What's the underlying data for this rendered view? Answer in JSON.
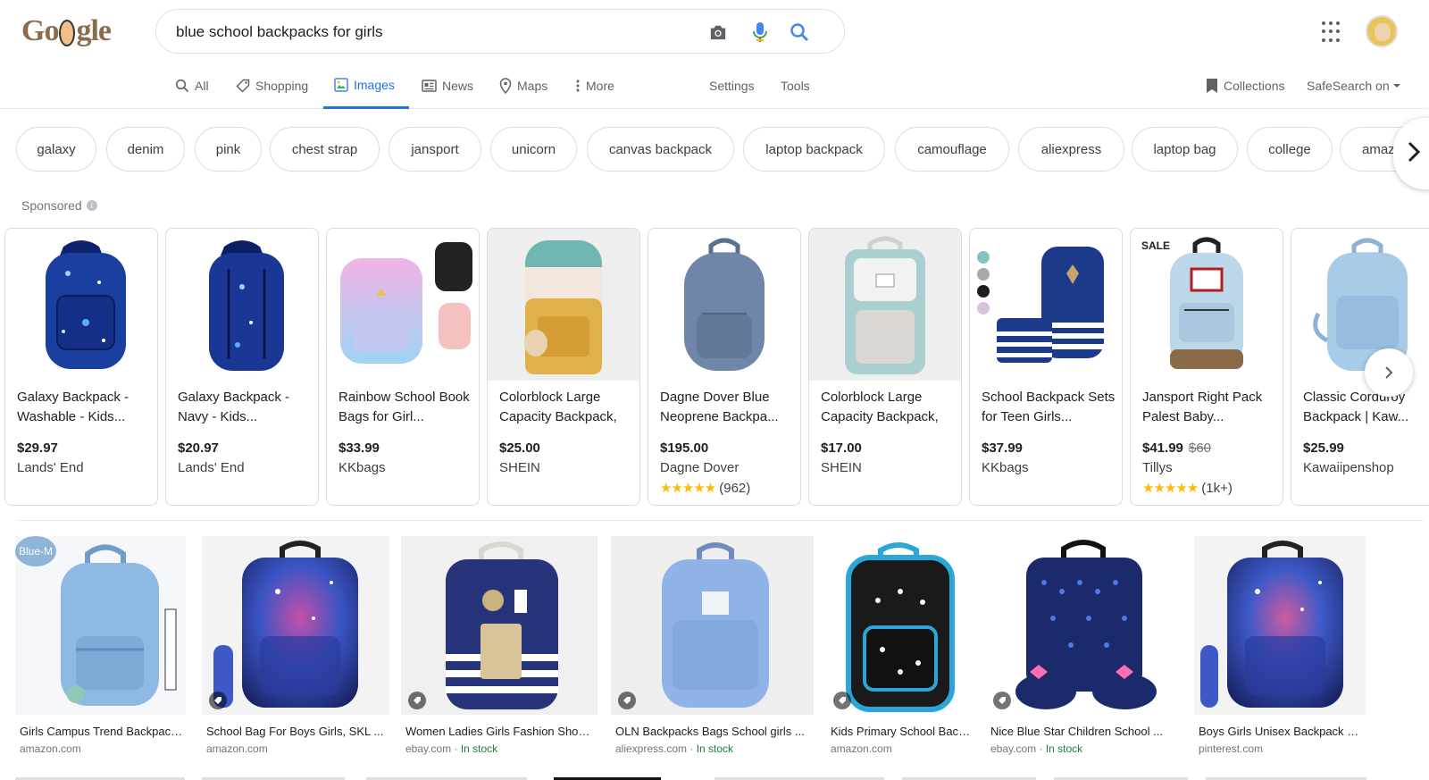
{
  "search": {
    "query": "blue school backpacks for girls"
  },
  "logo": {
    "text_g1": "Go",
    "text_g2": "gle"
  },
  "nav": {
    "all": "All",
    "shopping": "Shopping",
    "images": "Images",
    "news": "News",
    "maps": "Maps",
    "more": "More",
    "settings": "Settings",
    "tools": "Tools",
    "collections": "Collections",
    "safesearch": "SafeSearch on"
  },
  "chips": [
    "galaxy",
    "denim",
    "pink",
    "chest strap",
    "jansport",
    "unicorn",
    "canvas backpack",
    "laptop backpack",
    "camouflage",
    "aliexpress",
    "laptop bag",
    "college",
    "amazon"
  ],
  "sponsored_label": "Sponsored",
  "products": [
    {
      "title": "Galaxy Backpack - Washable - Kids...",
      "price": "$29.97",
      "store": "Lands' End",
      "color": "#1b3fa0"
    },
    {
      "title": "Galaxy Backpack - Navy - Kids...",
      "price": "$20.97",
      "store": "Lands' End",
      "color": "#1a3796"
    },
    {
      "title": "Rainbow School Book Bags for Girl...",
      "price": "$33.99",
      "store": "KKbags",
      "color": "#d9a6e8"
    },
    {
      "title": "Colorblock Large Capacity Backpack,",
      "price": "$25.00",
      "store": "SHEIN",
      "color": "#e0b04a"
    },
    {
      "title": "Dagne Dover Blue Neoprene Backpa...",
      "price": "$195.00",
      "store": "Dagne Dover",
      "rating_stars": "★★★★★",
      "rating_count": "(962)",
      "color": "#6f86a8"
    },
    {
      "title": "Colorblock Large Capacity Backpack,",
      "price": "$17.00",
      "store": "SHEIN",
      "color": "#a9cfcf"
    },
    {
      "title": "School Backpack Sets for Teen Girls...",
      "price": "$37.99",
      "store": "KKbags",
      "color": "#1d3a8a"
    },
    {
      "title": "Jansport Right Pack Palest Baby...",
      "price": "$41.99",
      "old_price": "$60",
      "store": "Tillys",
      "rating_stars": "★★★★★",
      "rating_count": "(1k+)",
      "badge": "SALE",
      "color": "#bcd6ea"
    },
    {
      "title": "Classic Corduroy Backpack | Kaw...",
      "price": "$25.99",
      "store": "Kawaiipenshop",
      "color": "#a8cbe8"
    }
  ],
  "swatch_colors": [
    "#7fc7c0",
    "#a7a9ac",
    "#1e1e1e",
    "#d9c2dc"
  ],
  "results": [
    {
      "title": "Girls Campus Trend Backpack ...",
      "source": "amazon.com",
      "stock": "",
      "badge": "Blue-M",
      "color": "#8db9e3",
      "bg": "#f5f7fa"
    },
    {
      "title": "School Bag For Boys Girls, SKL ...",
      "source": "amazon.com",
      "stock": "",
      "color": "#2c3c9e",
      "bg": "#f3f3f3"
    },
    {
      "title": "Women Ladies Girls Fashion Shoulder ...",
      "source": "ebay.com",
      "stock": "In stock",
      "color": "#27347a",
      "bg": "#f0f0f0"
    },
    {
      "title": "OLN Backpacks Bags School girls ...",
      "source": "aliexpress.com",
      "stock": "In stock",
      "color": "#8fb3e6",
      "bg": "#eeeeee"
    },
    {
      "title": "Kids Primary School Backpack ...",
      "source": "amazon.com",
      "stock": "",
      "color": "#1a1a1a",
      "bg": "#ffffff"
    },
    {
      "title": "Nice Blue Star Children School ...",
      "source": "ebay.com",
      "stock": "In stock",
      "color": "#1b2a6b",
      "bg": "#ffffff"
    },
    {
      "title": "Boys Girls Unisex Backpack Galaxy ...",
      "source": "pinterest.com",
      "stock": "",
      "color": "#2f3f99",
      "bg": "#f3f3f3"
    }
  ],
  "stock_separator": " · "
}
